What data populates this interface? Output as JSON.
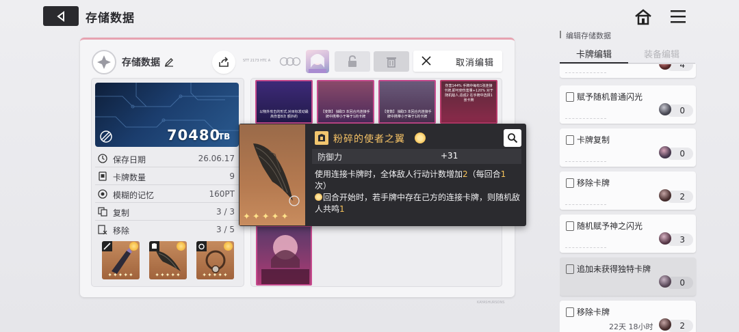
{
  "header": {
    "title": "存储数据"
  },
  "save": {
    "name": "存储数据",
    "small_text": "STT 2173 HTC A",
    "tb_value": "70480",
    "tb_unit": "TB"
  },
  "cancel_edit_label": "取消编辑",
  "stats": [
    {
      "label": "保存日期",
      "value": "26.06.17",
      "icon": "clock-icon"
    },
    {
      "label": "卡牌数量",
      "value": "9",
      "icon": "card-icon"
    },
    {
      "label": "模糊的记忆",
      "value": "160PT",
      "icon": "memory-icon"
    },
    {
      "label": "复制",
      "value": "3 / 3",
      "icon": "copy-icon"
    },
    {
      "label": "移除",
      "value": "3 / 5",
      "icon": "remove-icon"
    }
  ],
  "equipment": [
    {
      "type": "sword-icon",
      "stars": "✦✦✦✦✦"
    },
    {
      "type": "armor-icon",
      "stars": "✦✦✦✦✦"
    },
    {
      "type": "ring-icon",
      "stars": "✦✦✦✦✦"
    }
  ],
  "grid_cards": [
    {
      "tag": "",
      "text": "以物外攻击的形式,对目标发动最高伤害8次 额外的"
    },
    {
      "tag": "【变数】",
      "text": "【变数】 抽取3 本回合内连接手牌中携带小于等于1的卡牌"
    },
    {
      "tag": "【变数】",
      "text": "【变数】 抽取3 本回合内连接手牌中携带小于等于1的卡牌"
    },
    {
      "tag": "伤害",
      "text": "伤害144% 手牌中每有1张连接卡牌,即可使伤害量+120% 对于随机敌人,造成2 在手牌中选择1张卡牌"
    }
  ],
  "tooltip": {
    "title": "粉碎的使者之翼",
    "stat_label": "防御力",
    "stat_value": "+31",
    "desc1_a": "使用连接卡牌时，全体敌人行动计数增加",
    "desc1_num": "2",
    "desc1_b": "（每回合",
    "desc1_num2": "1",
    "desc1_c": "次）",
    "desc2_a": "回合开始时，若手牌中存在己方的连接卡牌，则随机敌人共鸣",
    "desc2_num": "1",
    "stars": "✦✦✦✦✦"
  },
  "right_panel": {
    "title": "编辑存储数据",
    "tabs": [
      "卡牌编辑",
      "装备编辑"
    ],
    "items": [
      {
        "label": "",
        "count": "4",
        "dim": false
      },
      {
        "label": "赋予随机普通闪光",
        "count": "0",
        "dim": false
      },
      {
        "label": "卡牌复制",
        "count": "0",
        "dim": false
      },
      {
        "label": "移除卡牌",
        "count": "2",
        "dim": false
      },
      {
        "label": "随机赋予神之闪光",
        "count": "3",
        "dim": false
      },
      {
        "label": "追加未获得独特卡牌",
        "count": "0",
        "dim": true
      },
      {
        "label": "移除卡牌",
        "count": "2",
        "dim": false
      }
    ],
    "time_left": "22天 18小时"
  },
  "footer_right": "KAYASHURSONS"
}
